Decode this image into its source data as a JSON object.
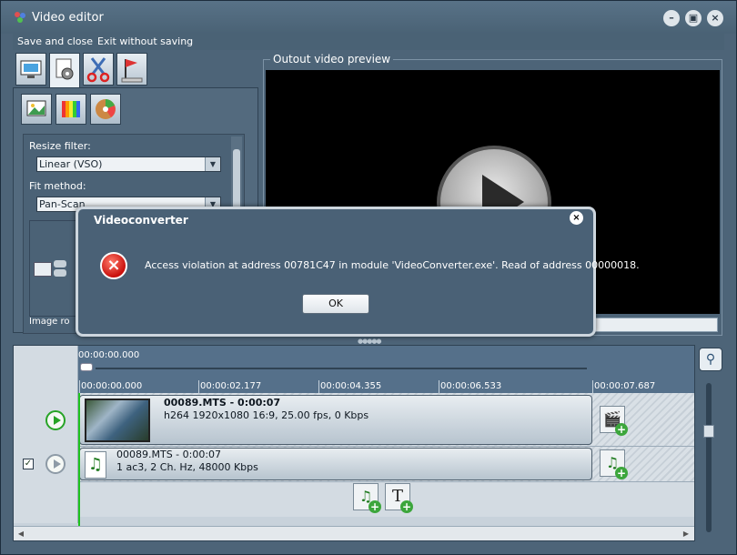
{
  "window": {
    "title": "Video editor",
    "controls": [
      "minimize",
      "maximize",
      "close"
    ]
  },
  "menu": {
    "save_close": "Save and close",
    "exit_without_saving": "Exit without saving"
  },
  "left_tabs": [
    "screen-icon",
    "settings-icon",
    "scissors-icon",
    "flag-icon"
  ],
  "sub_tabs": [
    "picture-icon",
    "color-bars-icon",
    "color-wheel-icon"
  ],
  "props": {
    "resize_filter_label": "Resize filter:",
    "resize_filter_value": "Linear (VSO)",
    "fit_method_label": "Fit method:",
    "fit_method_value": "Pan-Scan",
    "image_label_partial": "Image ro"
  },
  "preview": {
    "label": "Outout video preview"
  },
  "timeline": {
    "start_time": "00:00:00.000",
    "ticks": [
      "00:00:00.000",
      "00:00:02.177",
      "00:00:04.355",
      "00:00:06.533",
      "00:00:07.687"
    ],
    "video_clip": {
      "title": "00089.MTS - 0:00:07",
      "details": "h264 1920x1080 16:9, 25.00 fps, 0 Kbps"
    },
    "audio_clip": {
      "title": "00089.MTS - 0:00:07",
      "details": "1 ac3, 2 Ch. Hz, 48000 Kbps"
    }
  },
  "dialog": {
    "title": "Videoconverter",
    "message": "Access violation at address 00781C47 in module 'VideoConverter.exe'. Read of address 00000018.",
    "ok_label": "OK"
  }
}
